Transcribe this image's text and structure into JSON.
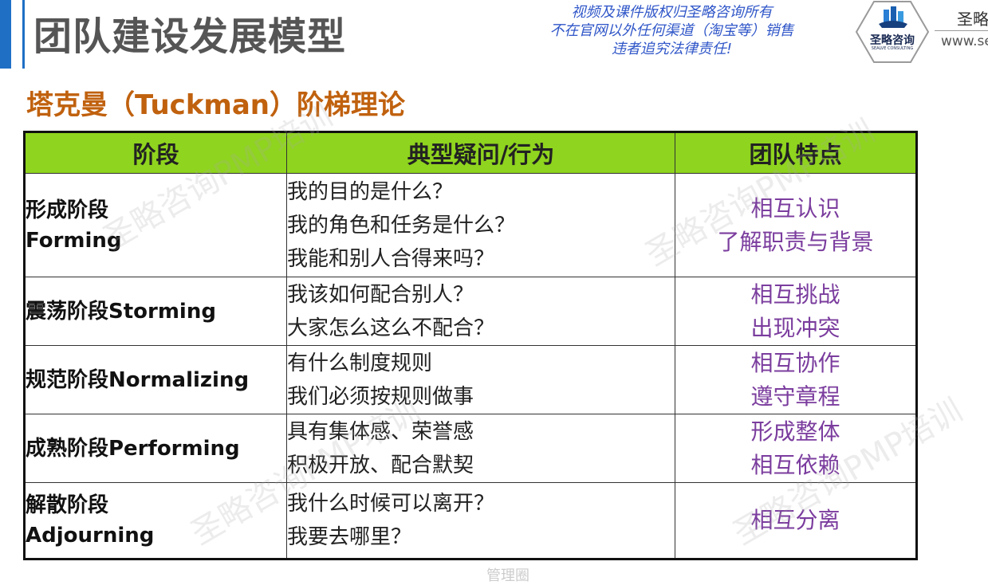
{
  "header": {
    "title": "团队建设发展模型",
    "copyright_lines": [
      "视频及课件版权归圣略咨询所有",
      "不在官网以外任何渠道（淘宝等）销售",
      "违者追究法律责任!"
    ],
    "logo_text": "圣略咨询",
    "logo_subtext": "SEALVE CONSULTING",
    "brand_name": "圣略",
    "brand_url": "www.se"
  },
  "subtitle": "塔克曼（Tuckman）阶梯理论",
  "table": {
    "headers": [
      "阶段",
      "典型疑问/行为",
      "团队特点"
    ],
    "rows": [
      {
        "stage": [
          "形成阶段",
          "Forming"
        ],
        "behaviors": [
          "我的目的是什么？",
          "我的角色和任务是什么？",
          "我能和别人合得来吗？"
        ],
        "traits": [
          "相互认识",
          "了解职责与背景"
        ]
      },
      {
        "stage": [
          "震荡阶段Storming"
        ],
        "behaviors": [
          "我该如何配合别人？",
          "大家怎么这么不配合？"
        ],
        "traits": [
          "相互挑战",
          "出现冲突"
        ]
      },
      {
        "stage": [
          "规范阶段Normalizing"
        ],
        "behaviors": [
          "有什么制度规则",
          "我们必须按规则做事"
        ],
        "traits": [
          "相互协作",
          "遵守章程"
        ]
      },
      {
        "stage": [
          "成熟阶段Performing"
        ],
        "behaviors": [
          "具有集体感、荣誉感",
          "积极开放、配合默契"
        ],
        "traits": [
          "形成整体",
          "相互依赖"
        ]
      },
      {
        "stage": [
          "解散阶段",
          "Adjourning"
        ],
        "behaviors": [
          "我什么时候可以离开？",
          "我要去哪里？"
        ],
        "traits": [
          "相互分离"
        ]
      }
    ]
  },
  "watermarks": [
    "圣略咨询PMP培训",
    "圣略咨询PMP培训",
    "圣略咨询PMP培训",
    "圣略咨询PMP培训"
  ],
  "bottom_mark": "管理圈",
  "colors": {
    "accent": "#1f6fc5",
    "header_fill": "#8fd41e",
    "subtitle": "#c0610e",
    "traits_text": "#7b3d9e",
    "copyright_text": "#2f56c8"
  }
}
